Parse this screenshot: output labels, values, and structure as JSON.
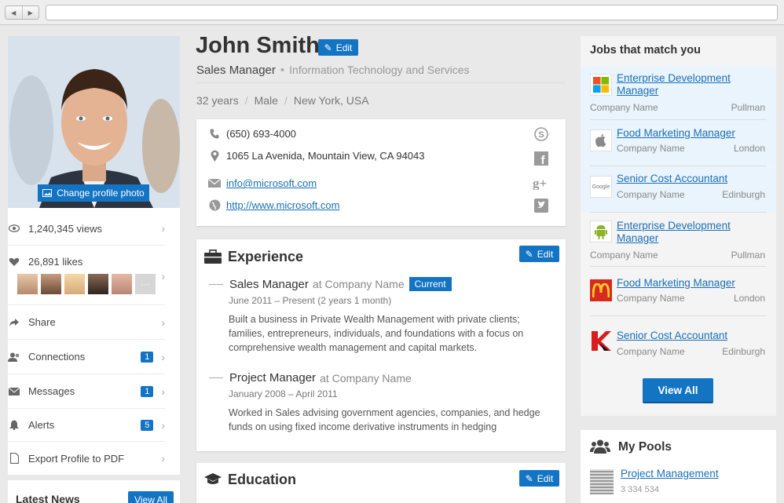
{
  "profile": {
    "name": "John Smith",
    "edit_label": "Edit",
    "title": "Sales Manager",
    "industry": "Information Technology and Services",
    "age": "32 years",
    "gender": "Male",
    "location": "New York, USA",
    "change_photo_label": "Change profile photo"
  },
  "contact": {
    "phone": "(650) 693-4000",
    "address": "1065 La Avenida, Mountain View, CA 94043",
    "email": "info@microsoft.com",
    "website": "http://www.microsoft.com",
    "social_icons": [
      "skype-icon",
      "facebook-icon",
      "google-plus-icon",
      "twitter-icon"
    ]
  },
  "stats": {
    "views": "1,240,345 views",
    "likes": "26,891 likes",
    "more_label": "···"
  },
  "left_menu": [
    {
      "label": "Share",
      "badge": ""
    },
    {
      "label": "Connections",
      "badge": "1"
    },
    {
      "label": "Messages",
      "badge": "1"
    },
    {
      "label": "Alerts",
      "badge": "5"
    },
    {
      "label": "Export Profile to PDF",
      "badge": ""
    }
  ],
  "news": {
    "title": "Latest News",
    "view_all_label": "View All"
  },
  "experience": {
    "title": "Experience",
    "edit_label": "Edit",
    "jobs": [
      {
        "role": "Sales Manager",
        "company": "at Company Name",
        "badge": "Current",
        "dates": "June 2011 – Present (2 years 1 month)",
        "description": "Built a business in Private Wealth Management with private clients; families, entrepreneurs, individuals, and foundations with a focus on comprehensive wealth management and capital markets."
      },
      {
        "role": "Project Manager",
        "company": "at Company Name",
        "badge": "",
        "dates": "January 2008 – April 2011",
        "description": "Worked in Sales advising government agencies, companies, and hedge funds on using fixed income derivative instruments in hedging"
      }
    ]
  },
  "education": {
    "title": "Education",
    "edit_label": "Edit"
  },
  "jobs_panel": {
    "title": "Jobs that match you",
    "view_all_label": "View All",
    "items": [
      {
        "title": "Enterprise Development Manager",
        "company": "Company Name",
        "city": "Pullman",
        "logo": "microsoft-logo-icon"
      },
      {
        "title": "Food Marketing Manager",
        "company": "Company Name",
        "city": "London",
        "logo": "apple-logo-icon"
      },
      {
        "title": "Senior Cost Accountant",
        "company": "Company Name",
        "city": "Edinburgh",
        "logo": "google-logo-icon"
      },
      {
        "title": "Enterprise Development Manager",
        "company": "Company Name",
        "city": "Pullman",
        "logo": "android-logo-icon"
      },
      {
        "title": "Food Marketing Manager",
        "company": "Company Name",
        "city": "London",
        "logo": "mcdonalds-logo-icon"
      },
      {
        "title": "Senior Cost Accountant",
        "company": "Company Name",
        "city": "Edinburgh",
        "logo": "kaspersky-logo-icon"
      }
    ],
    "google_logo_text": "Google"
  },
  "pools": {
    "title": "My Pools",
    "items": [
      {
        "title": "Project Management",
        "count": "3 334 534"
      }
    ]
  },
  "colors": {
    "accent": "#1474c4",
    "link": "#1a6fb5"
  }
}
